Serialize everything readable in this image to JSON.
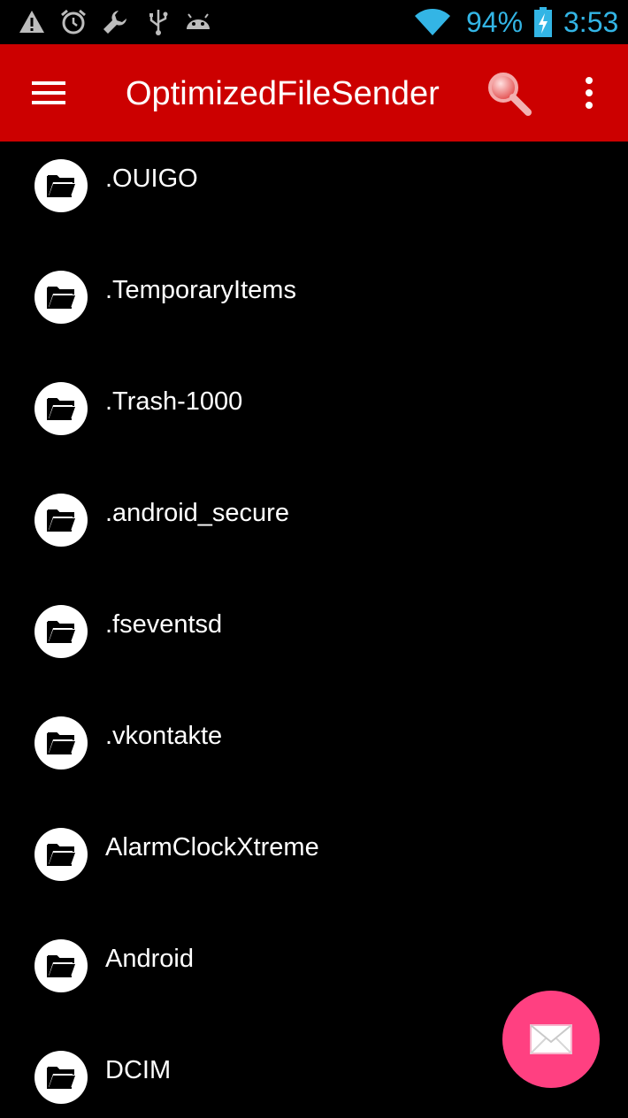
{
  "status_bar": {
    "icons": [
      "warning-icon",
      "alarm-clock-icon",
      "wrench-icon",
      "usb-icon",
      "android-debug-icon",
      "wifi-icon",
      "battery-charging-icon"
    ],
    "battery_percent": "94%",
    "time": "3:53",
    "accent_color": "#33b5e5"
  },
  "app_bar": {
    "title": "OptimizedFileSender",
    "background_color": "#cc0000",
    "icons": [
      "menu-icon",
      "search-icon",
      "overflow-menu-icon"
    ]
  },
  "file_list": {
    "items": [
      {
        "name": ".OUIGO",
        "icon": "folder-icon"
      },
      {
        "name": ".TemporaryItems",
        "icon": "folder-icon"
      },
      {
        "name": ".Trash-1000",
        "icon": "folder-icon"
      },
      {
        "name": ".android_secure",
        "icon": "folder-icon"
      },
      {
        "name": ".fseventsd",
        "icon": "folder-icon"
      },
      {
        "name": ".vkontakte",
        "icon": "folder-icon"
      },
      {
        "name": "AlarmClockXtreme",
        "icon": "folder-icon"
      },
      {
        "name": "Android",
        "icon": "folder-icon"
      },
      {
        "name": "DCIM",
        "icon": "folder-icon"
      }
    ]
  },
  "fab": {
    "icon": "envelope-icon",
    "color": "#ff4081"
  }
}
